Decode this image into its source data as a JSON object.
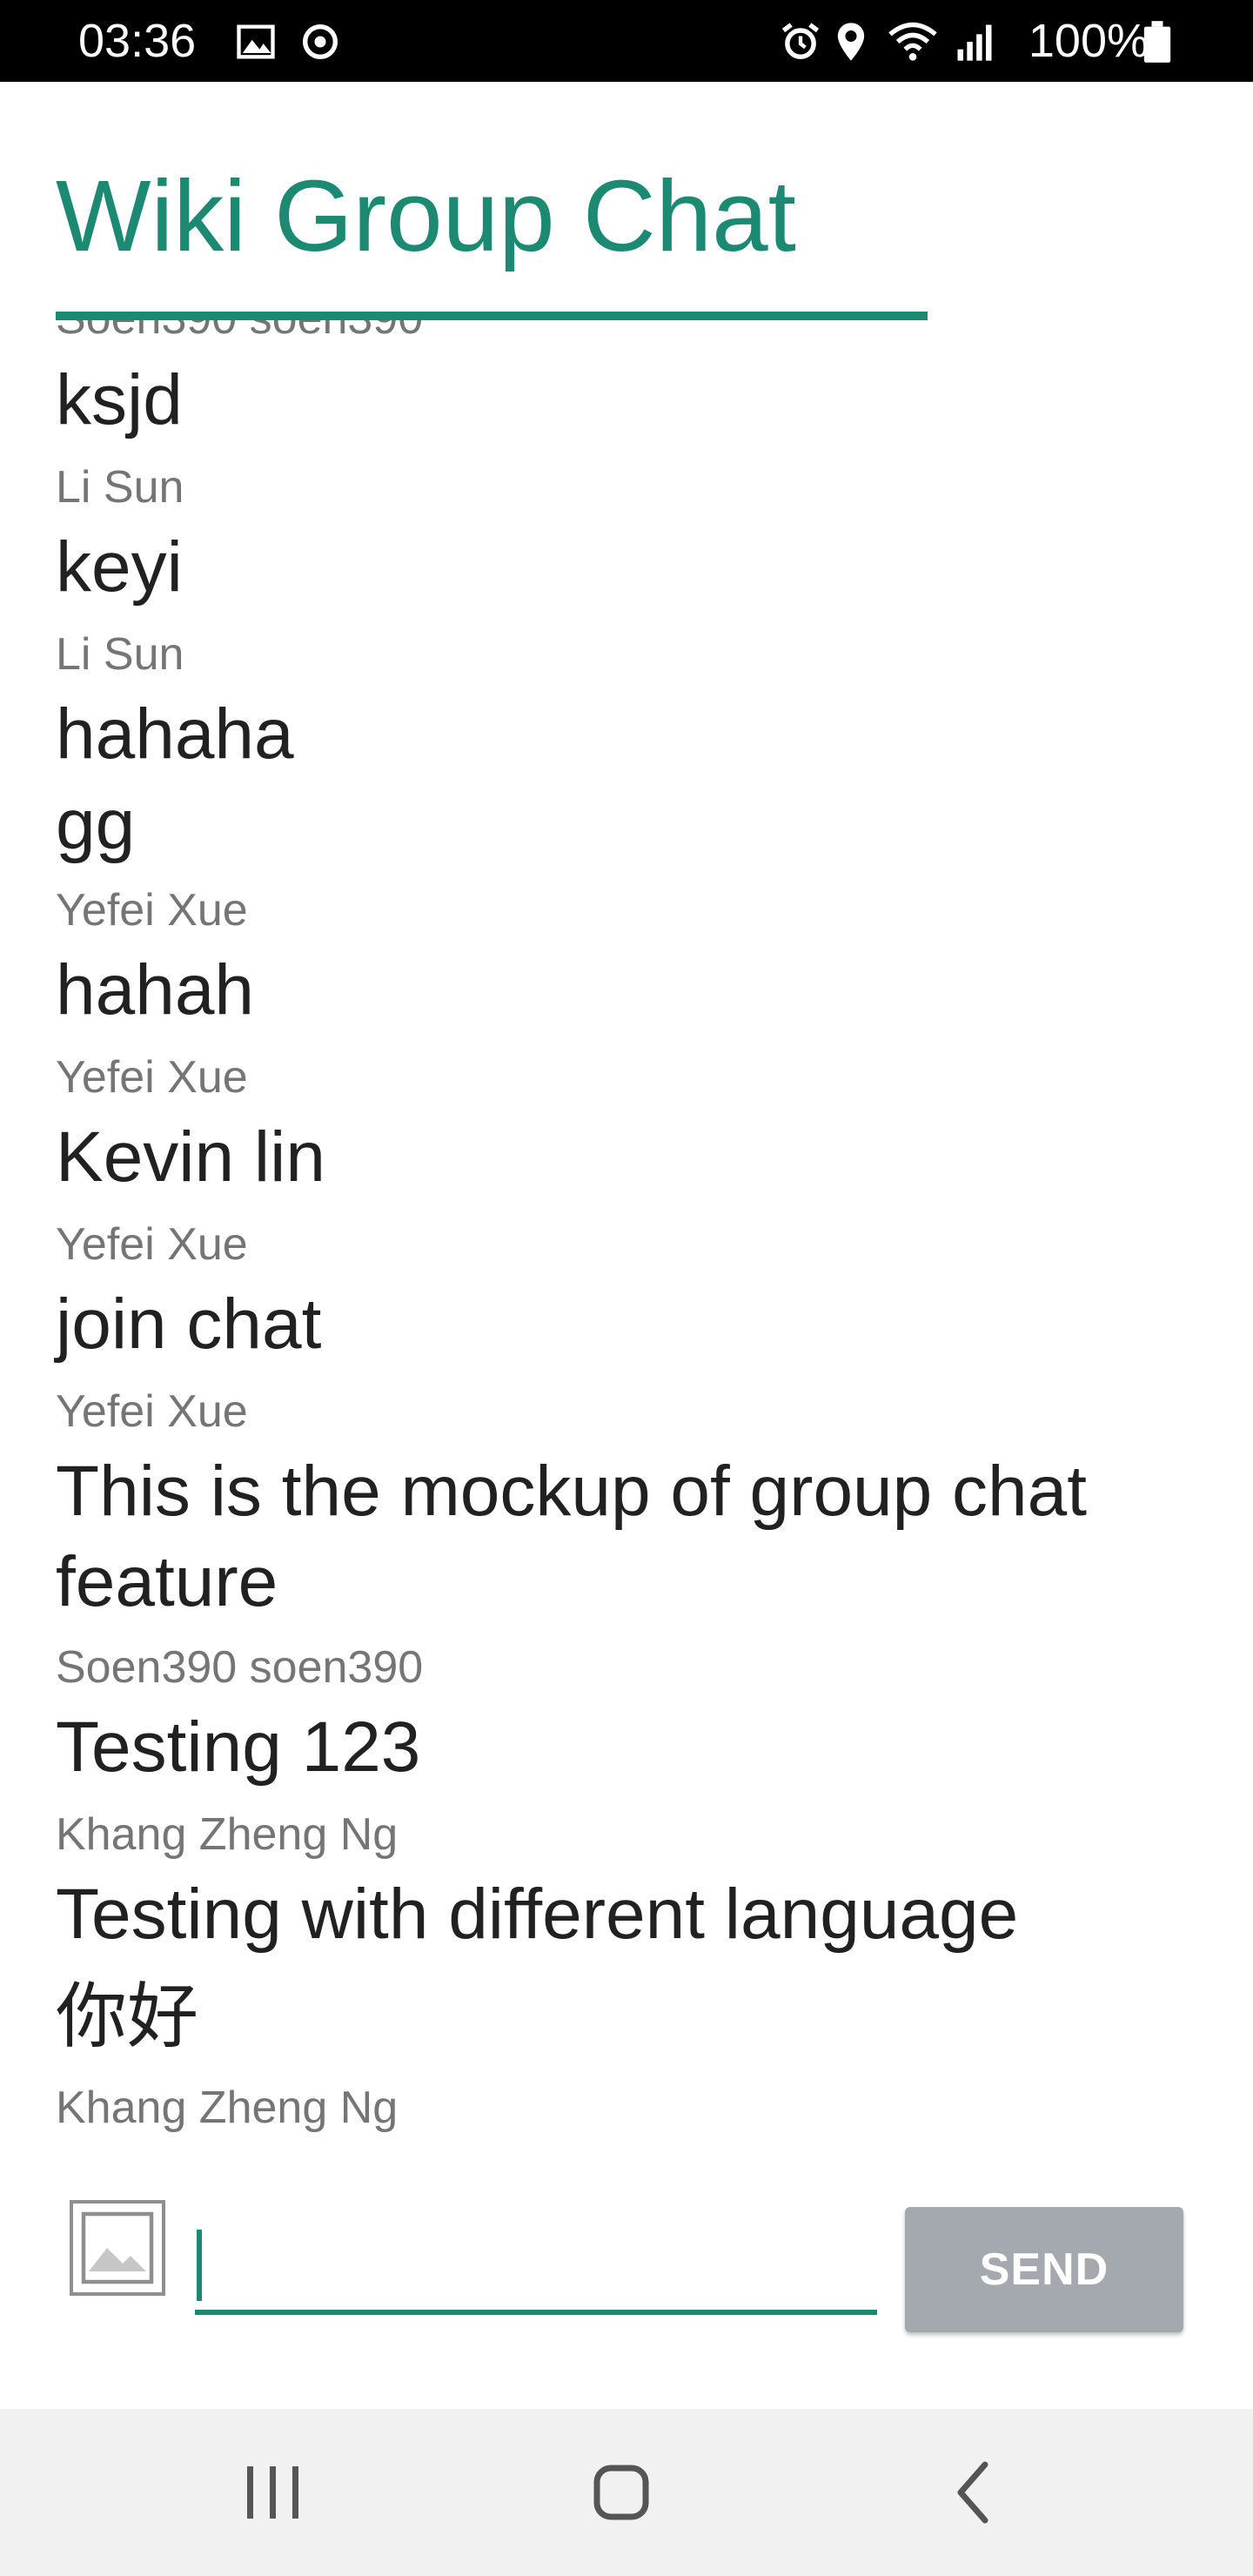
{
  "status_bar": {
    "time": "03:36",
    "battery": "100%",
    "icons": [
      "image-icon",
      "sync-icon",
      "alarm-icon",
      "location-icon",
      "wifi-icon",
      "signal-icon",
      "battery-icon"
    ]
  },
  "header": {
    "title": "Wiki Group Chat",
    "accent_color": "#1c8a72"
  },
  "messages": [
    {
      "text": "Soen390 soen390",
      "author": "",
      "partially_hidden": true
    },
    {
      "text": "ksjd",
      "author": "Li Sun"
    },
    {
      "text": "keyi",
      "author": "Li Sun"
    },
    {
      "text": "hahaha",
      "text2": "gg",
      "author": "Yefei Xue"
    },
    {
      "text": "hahah",
      "author": "Yefei Xue"
    },
    {
      "text": "Kevin lin",
      "author": "Yefei Xue"
    },
    {
      "text": "join chat",
      "author": "Yefei Xue"
    },
    {
      "text": "This is the mockup of group chat",
      "text2": "feature",
      "author": "Soen390 soen390"
    },
    {
      "text": "Testing 123",
      "author": "Khang Zheng Ng"
    },
    {
      "text": "Testing with different language",
      "text2": "你好",
      "author": "Khang Zheng Ng"
    }
  ],
  "composer": {
    "input_value": "",
    "send_label": "SEND",
    "send_color": "#a3a9af",
    "image_button_icon": "image-icon"
  },
  "nav_bar": {
    "buttons": [
      "recent-apps-icon",
      "home-icon",
      "back-icon"
    ]
  }
}
